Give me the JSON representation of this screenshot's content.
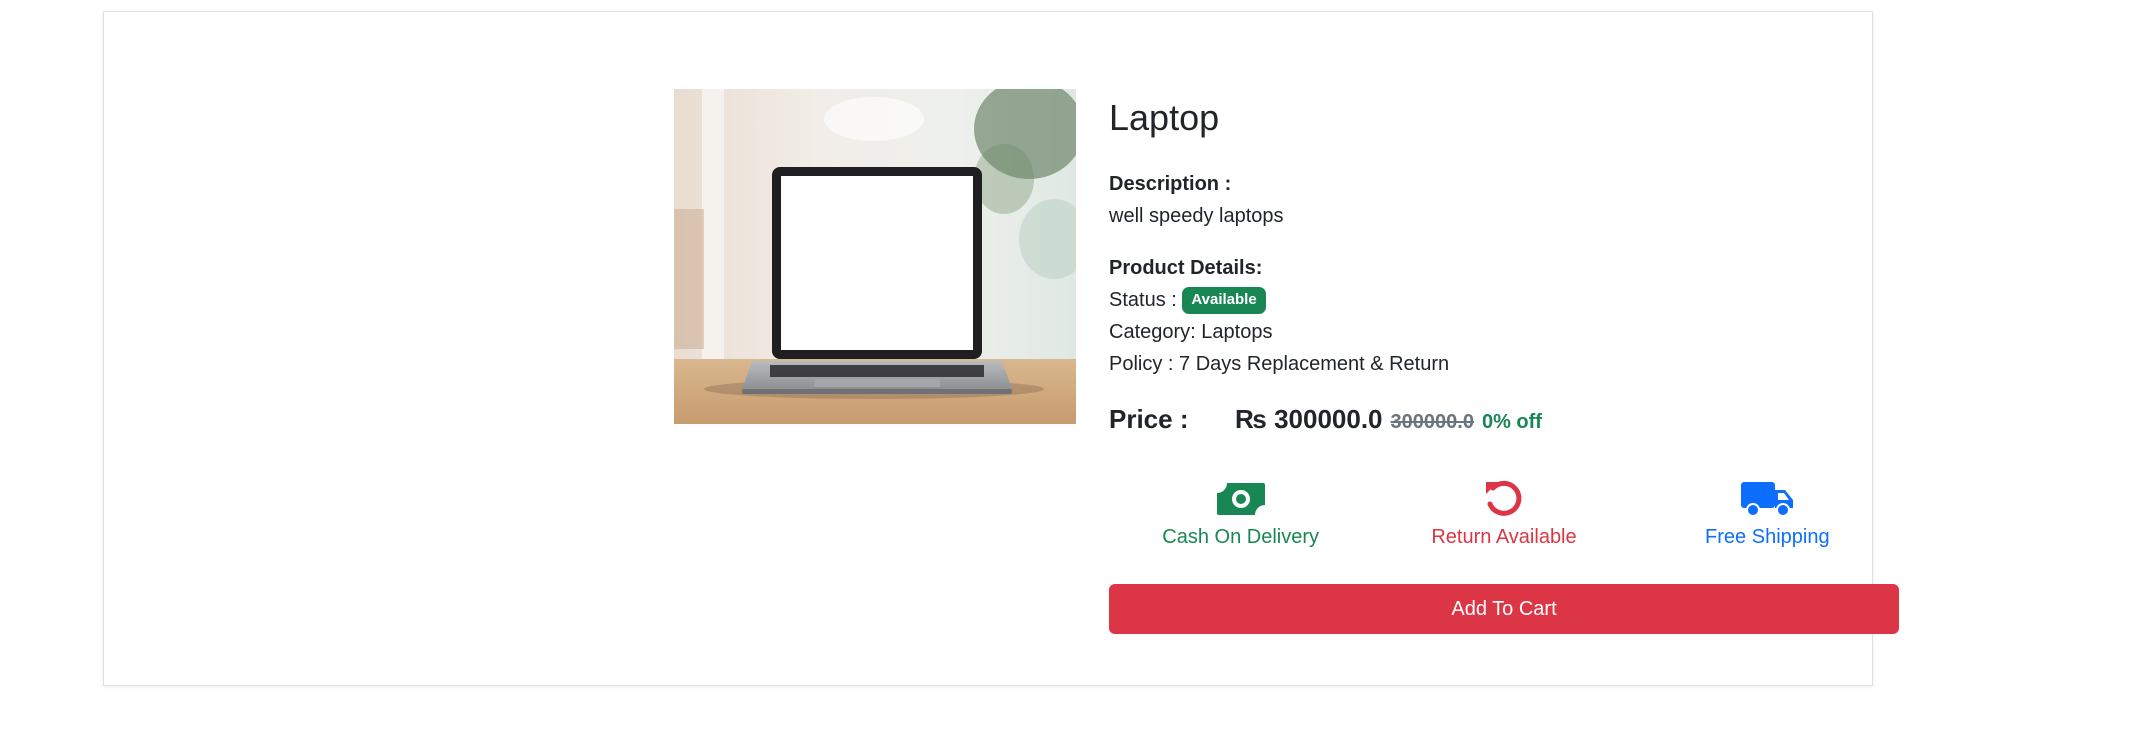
{
  "product": {
    "title": "Laptop",
    "image_alt": "laptop photo",
    "description_label": "Description :",
    "description": "well speedy laptops",
    "details_label": "Product Details:",
    "status_label": "Status :",
    "status_badge": "Available",
    "category": "Category: Laptops",
    "policy": "Policy : 7 Days Replacement & Return",
    "price_label": "Price :",
    "price": "₨ 300000.0",
    "original_price": "300000.0",
    "discount": "0% off"
  },
  "features": [
    {
      "label": "Cash On Delivery",
      "icon": "money-bill-icon",
      "color": "#198754"
    },
    {
      "label": "Return Available",
      "icon": "undo-icon",
      "color": "#dc3545"
    },
    {
      "label": "Free Shipping",
      "icon": "truck-icon",
      "color": "#0d6efd"
    }
  ],
  "actions": {
    "add_to_cart": "Add To Cart"
  },
  "colors": {
    "success": "#198754",
    "danger": "#dc3545",
    "primary": "#0d6efd",
    "muted": "#6c757d"
  }
}
